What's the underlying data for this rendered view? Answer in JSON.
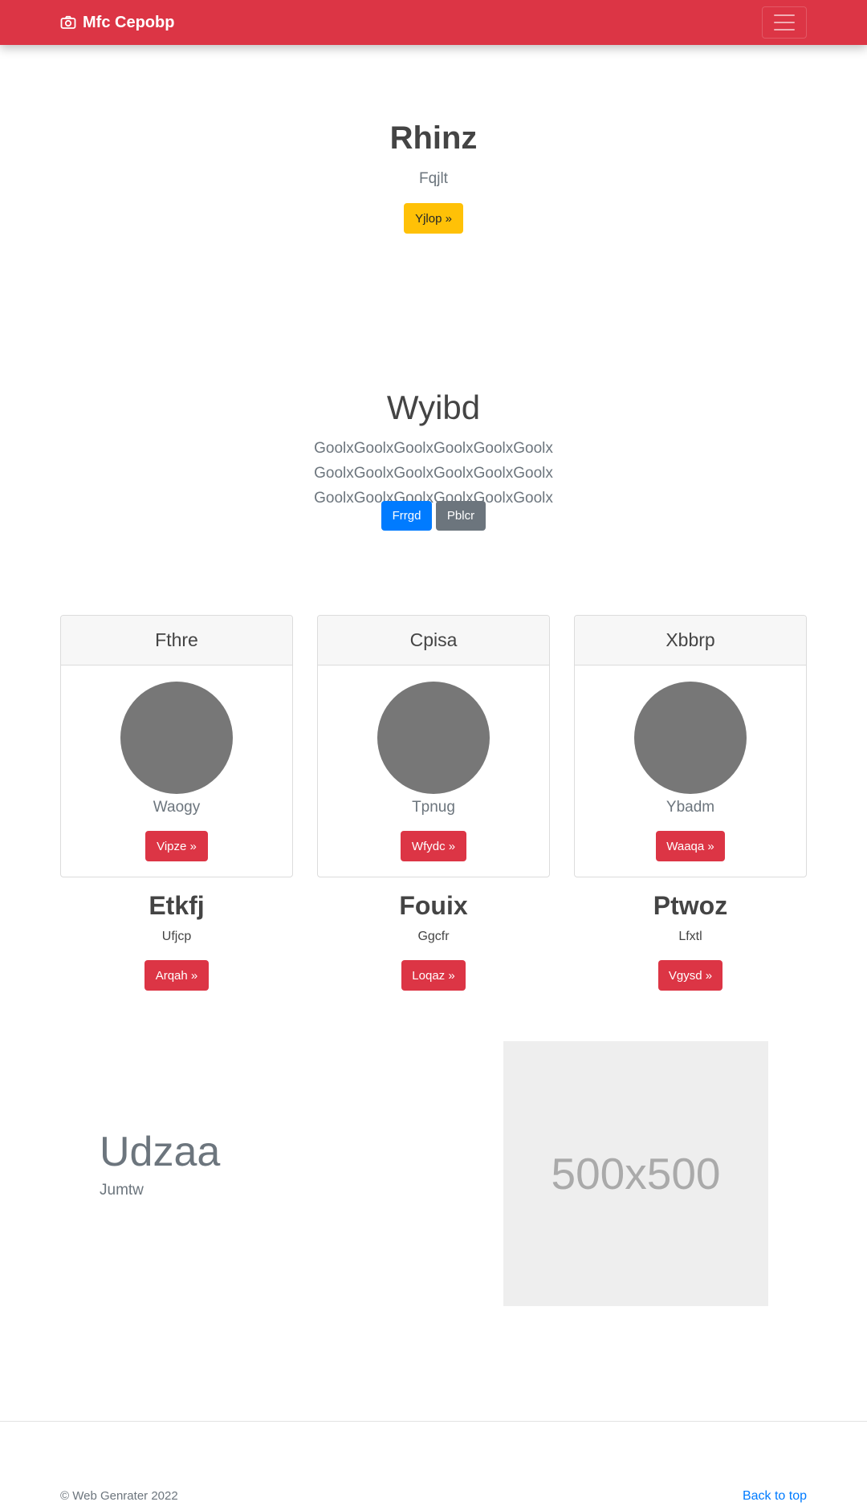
{
  "navbar": {
    "brand": "Mfc Cepobp",
    "brand_icon": "camera-icon",
    "toggler_icon": "hamburger-menu-icon"
  },
  "hero": {
    "title": "Rhinz",
    "subtitle": "Fqjlt",
    "button": "Yjlop »",
    "button_color": "#ffc107"
  },
  "section": {
    "title": "Wyibd",
    "text": "GoolxGoolxGoolxGoolxGoolxGoolx GoolxGoolxGoolxGoolxGoolxGoolx GoolxGoolxGoolxGoolxGoolxGoolx",
    "primary_button": "Frrgd",
    "secondary_button": "Pblcr"
  },
  "cards": [
    {
      "header": "Fthre",
      "caption": "Waogy",
      "button": "Vipze »"
    },
    {
      "header": "Cpisa",
      "caption": "Tpnug",
      "button": "Wfydc »"
    },
    {
      "header": "Xbbrp",
      "caption": "Ybadm",
      "button": "Waaqa »"
    }
  ],
  "columns": [
    {
      "title": "Etkfj",
      "text": "Ufjcp",
      "button": "Arqah »"
    },
    {
      "title": "Fouix",
      "text": "Ggcfr",
      "button": "Loqaz »"
    },
    {
      "title": "Ptwoz",
      "text": "Lfxtl",
      "button": "Vgysd »"
    }
  ],
  "feature": {
    "title": "Udzaa",
    "subtitle": "Jumtw",
    "image_label": "500x500"
  },
  "footer": {
    "copyright": "© Web Genrater 2022",
    "back_to_top": "Back to top"
  },
  "colors": {
    "brand": "#dc3545",
    "primary": "#007bff",
    "secondary": "#6c757d",
    "warning": "#ffc107",
    "danger": "#dc3545"
  }
}
